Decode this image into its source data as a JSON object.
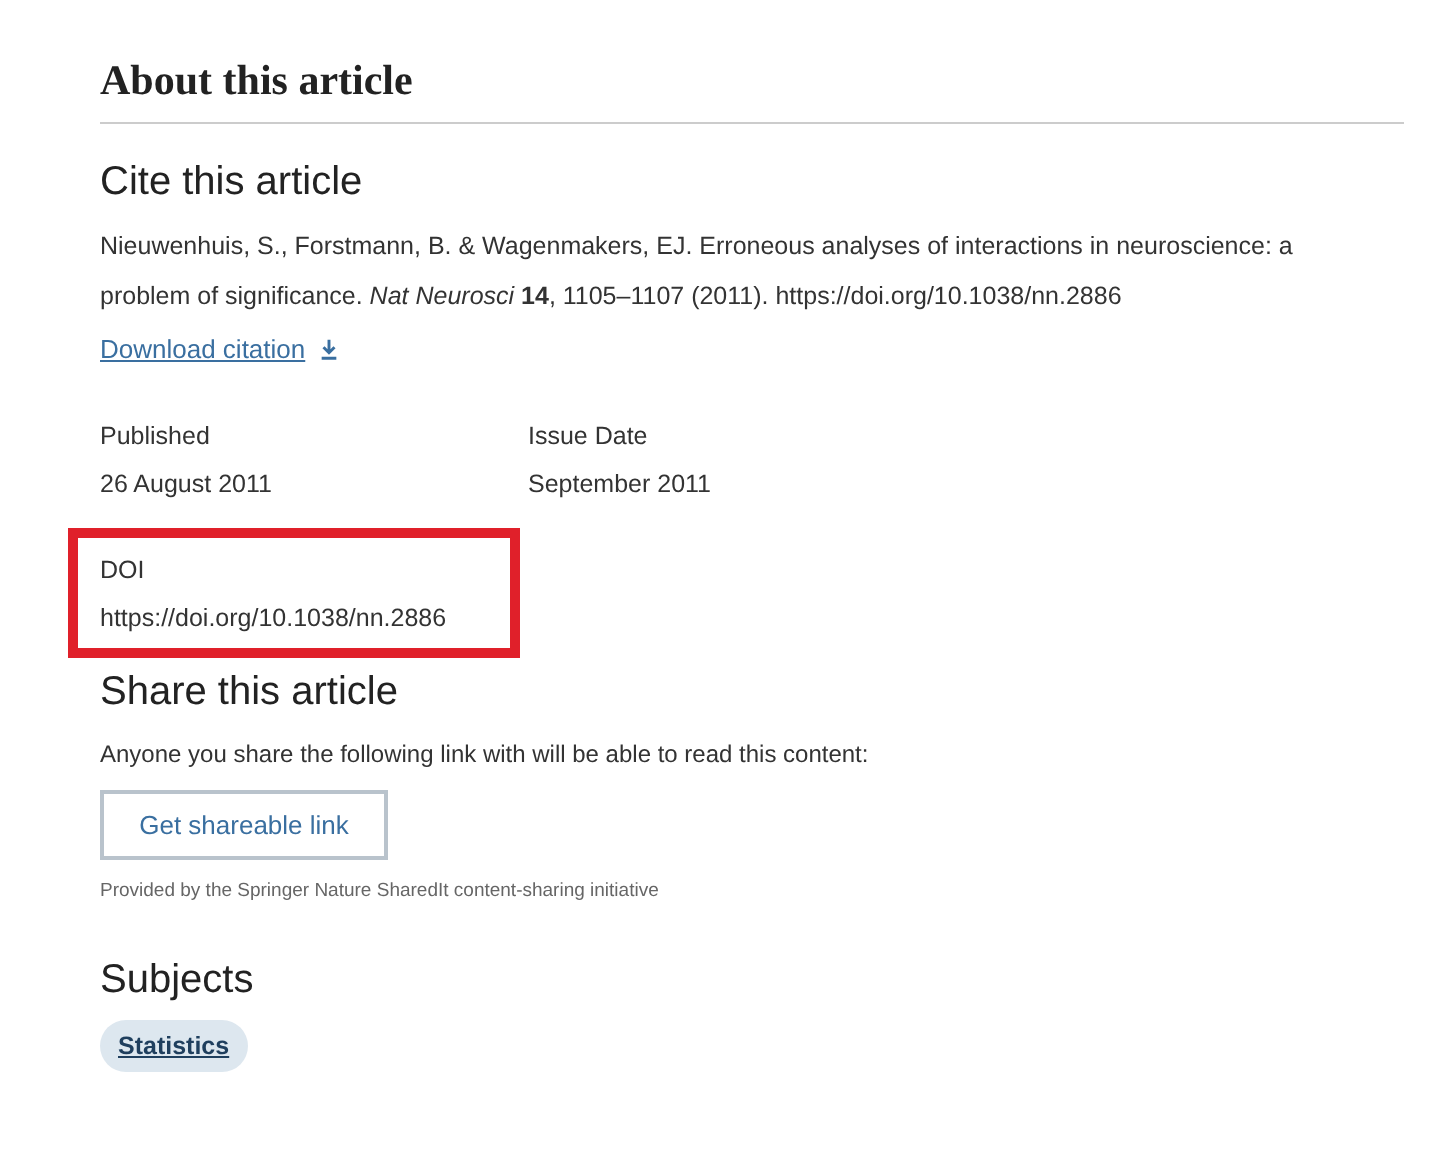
{
  "heading": "About this article",
  "cite": {
    "title": "Cite this article",
    "citation": "Nieuwenhuis, S., Forstmann, B. & Wagenmakers, EJ. Erroneous analyses of interactions in neuroscience: a problem of significance. *Nat Neurosci* **14**, 1105–1107 (2011). https://doi.org/10.1038/nn.2886",
    "download_link": "Download citation"
  },
  "details": [
    {
      "label": "Published",
      "value": "26 August 2011",
      "highlighted": false
    },
    {
      "label": "Issue Date",
      "value": "September 2011",
      "highlighted": false
    },
    {
      "label": "DOI",
      "value": "https://doi.org/10.1038/nn.2886",
      "highlighted": true
    }
  ],
  "share": {
    "title": "Share this article",
    "text": "Anyone you share the following link with will be able to read this content:",
    "button": "Get shareable link",
    "note": "Provided by the Springer Nature SharedIt content-sharing initiative"
  },
  "subjects": {
    "title": "Subjects",
    "tags": [
      "Statistics"
    ]
  }
}
